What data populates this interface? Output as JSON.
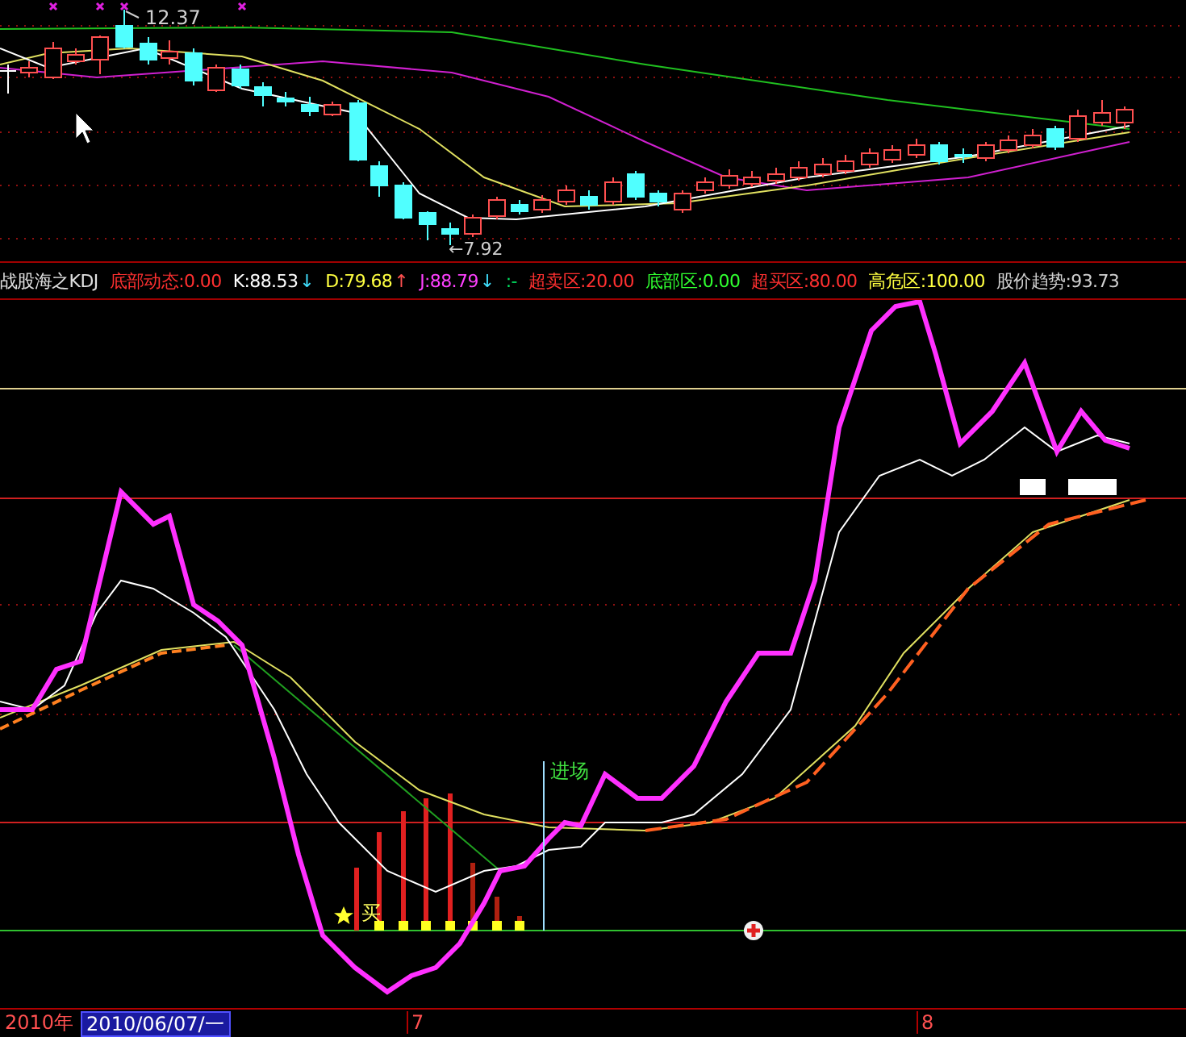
{
  "price_panel": {
    "high_label": "12.37",
    "low_label": "←7.92"
  },
  "indicator_legend": [
    {
      "text": "战股海之KDJ",
      "color": "#e0e0e0"
    },
    {
      "text": "底部动态:0.00",
      "color": "#ff3030"
    },
    {
      "text": "K:88.53",
      "color": "#ffffff",
      "arrow": {
        "text": "↓",
        "color": "#40e0ff"
      }
    },
    {
      "text": "D:79.68",
      "color": "#ffff40",
      "arrow": {
        "text": "↑",
        "color": "#ff5050"
      }
    },
    {
      "text": "J:88.79",
      "color": "#ff40ff",
      "arrow": {
        "text": "↓",
        "color": "#40e0ff"
      }
    },
    {
      "text": ":-",
      "color": "#00e060"
    },
    {
      "text": "超卖区:20.00",
      "color": "#ff3030"
    },
    {
      "text": "底部区:0.00",
      "color": "#30ff30"
    },
    {
      "text": "超买区:80.00",
      "color": "#ff3030"
    },
    {
      "text": "高危区:100.00",
      "color": "#ffff40"
    },
    {
      "text": "股价趋势:93.73",
      "color": "#d0d0d0"
    }
  ],
  "indicator_panel": {
    "entry_label": "进场",
    "buy_label": "买"
  },
  "time_axis": {
    "year": "2010年",
    "cursor_date": "2010/06/07/一",
    "ticks": [
      "7",
      "8"
    ]
  }
}
